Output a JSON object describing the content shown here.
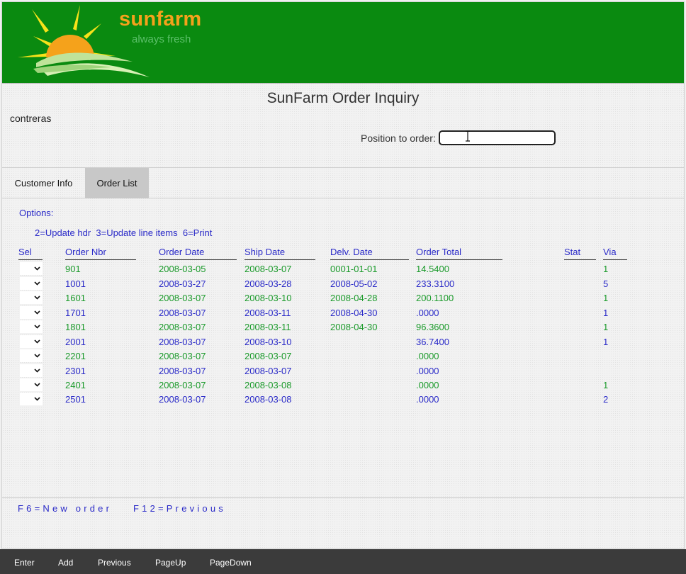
{
  "brand": {
    "name": "sunfarm",
    "tagline": "always fresh"
  },
  "page_title": "SunFarm Order Inquiry",
  "user": "contreras",
  "position": {
    "label": "Position to order:",
    "value": ""
  },
  "tabs": [
    {
      "label": "Customer Info",
      "active": false
    },
    {
      "label": "Order List",
      "active": true
    }
  ],
  "options": {
    "label": "Options:",
    "text": "2=Update hdr  3=Update line items  6=Print"
  },
  "columns": {
    "sel": "Sel",
    "order_nbr": "Order Nbr",
    "order_date": "Order Date",
    "ship_date": "Ship Date",
    "delv_date": "Delv. Date",
    "order_total": "Order Total",
    "stat": "Stat",
    "via": "Via"
  },
  "orders": [
    {
      "order_nbr": "901",
      "order_date": "2008-03-05",
      "ship_date": "2008-03-07",
      "delv_date": "0001-01-01",
      "order_total": "14.5400",
      "stat": "",
      "via": "1"
    },
    {
      "order_nbr": "1001",
      "order_date": "2008-03-27",
      "ship_date": "2008-03-28",
      "delv_date": "2008-05-02",
      "order_total": "233.3100",
      "stat": "",
      "via": "5"
    },
    {
      "order_nbr": "1601",
      "order_date": "2008-03-07",
      "ship_date": "2008-03-10",
      "delv_date": "2008-04-28",
      "order_total": "200.1100",
      "stat": "",
      "via": "1"
    },
    {
      "order_nbr": "1701",
      "order_date": "2008-03-07",
      "ship_date": "2008-03-11",
      "delv_date": "2008-04-30",
      "order_total": ".0000",
      "stat": "",
      "via": "1"
    },
    {
      "order_nbr": "1801",
      "order_date": "2008-03-07",
      "ship_date": "2008-03-11",
      "delv_date": "2008-04-30",
      "order_total": "96.3600",
      "stat": "",
      "via": "1"
    },
    {
      "order_nbr": "2001",
      "order_date": "2008-03-07",
      "ship_date": "2008-03-10",
      "delv_date": "",
      "order_total": "36.7400",
      "stat": "",
      "via": "1"
    },
    {
      "order_nbr": "2201",
      "order_date": "2008-03-07",
      "ship_date": "2008-03-07",
      "delv_date": "",
      "order_total": ".0000",
      "stat": "",
      "via": ""
    },
    {
      "order_nbr": "2301",
      "order_date": "2008-03-07",
      "ship_date": "2008-03-07",
      "delv_date": "",
      "order_total": ".0000",
      "stat": "",
      "via": ""
    },
    {
      "order_nbr": "2401",
      "order_date": "2008-03-07",
      "ship_date": "2008-03-08",
      "delv_date": "",
      "order_total": ".0000",
      "stat": "",
      "via": "1"
    },
    {
      "order_nbr": "2501",
      "order_date": "2008-03-07",
      "ship_date": "2008-03-08",
      "delv_date": "",
      "order_total": ".0000",
      "stat": "",
      "via": "2"
    }
  ],
  "function_keys": {
    "f6": "F6=New order",
    "f12": "F12=Previous"
  },
  "bottom_buttons": {
    "enter": "Enter",
    "add": "Add",
    "previous": "Previous",
    "pageup": "PageUp",
    "pagedown": "PageDown"
  },
  "colors": {
    "header_green": "#0a8a10",
    "brand_orange": "#f5a21b",
    "row_green": "#1a9a2a",
    "row_blue": "#2a2ac8"
  },
  "icons": {
    "logo": "sun-logo-icon",
    "select": "chevron-down-icon",
    "cursor": "text-cursor-icon"
  }
}
